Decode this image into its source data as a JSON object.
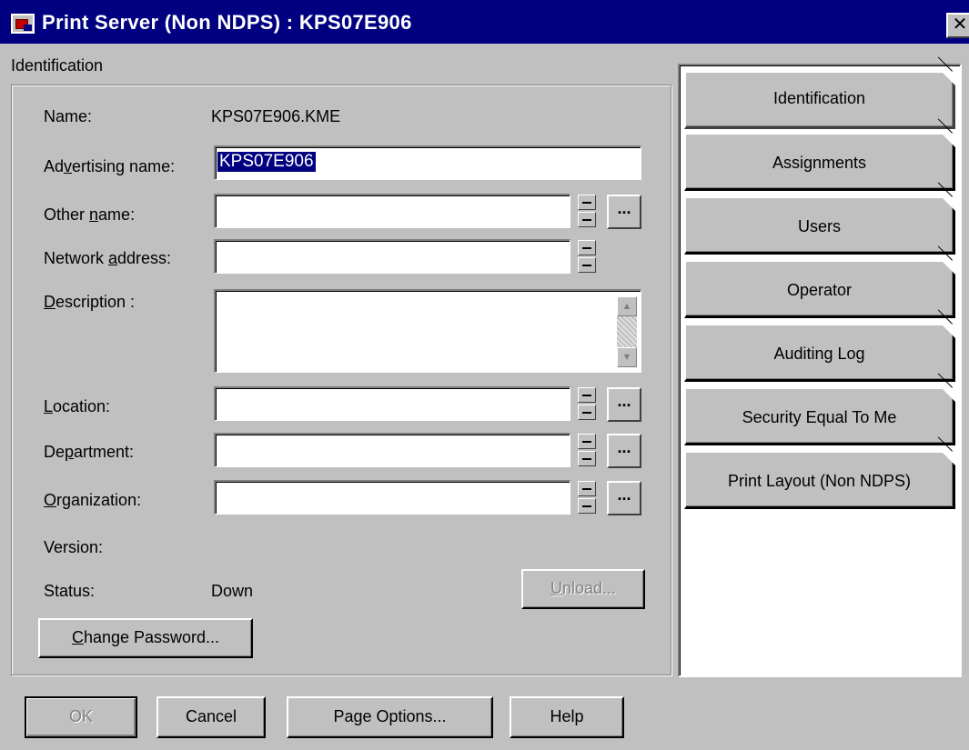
{
  "window": {
    "title": "Print Server (Non NDPS) : KPS07E906",
    "close_label": "✕"
  },
  "group": {
    "label": "Identification"
  },
  "fields": {
    "name_label": "Name:",
    "name_value": "KPS07E906.KME",
    "advertising_label_pre": "Ad",
    "advertising_label_u": "v",
    "advertising_label_post": "ertising name:",
    "advertising_value": "KPS07E906",
    "other_label_pre": "Other ",
    "other_label_u": "n",
    "other_label_post": "ame:",
    "network_label_pre": "Network ",
    "network_label_u": "a",
    "network_label_post": "ddress:",
    "description_label_u": "D",
    "description_label_post": "escription :",
    "location_label_u": "L",
    "location_label_post": "ocation:",
    "department_label_pre": "De",
    "department_label_u": "p",
    "department_label_post": "artment:",
    "organization_label_u": "O",
    "organization_label_post": "rganization:",
    "version_label": "Version:",
    "status_label": "Status:",
    "status_value": "Down"
  },
  "buttons": {
    "ellipsis": "...",
    "unload_u": "U",
    "unload_post": "nload...",
    "change_password_u": "C",
    "change_password_post": "hange Password...",
    "ok": "OK",
    "cancel": "Cancel",
    "page_options": "Page Options...",
    "help": "Help"
  },
  "tabs": [
    {
      "label": "Identification",
      "active": true
    },
    {
      "label": "Assignments"
    },
    {
      "label": "Users"
    },
    {
      "label": "Operator"
    },
    {
      "label": "Auditing Log"
    },
    {
      "label": "Security Equal To Me"
    },
    {
      "label": "Print Layout (Non NDPS)"
    }
  ],
  "colors": {
    "title_bar": "#000080",
    "face": "#c0c0c0",
    "selection": "#000080"
  }
}
